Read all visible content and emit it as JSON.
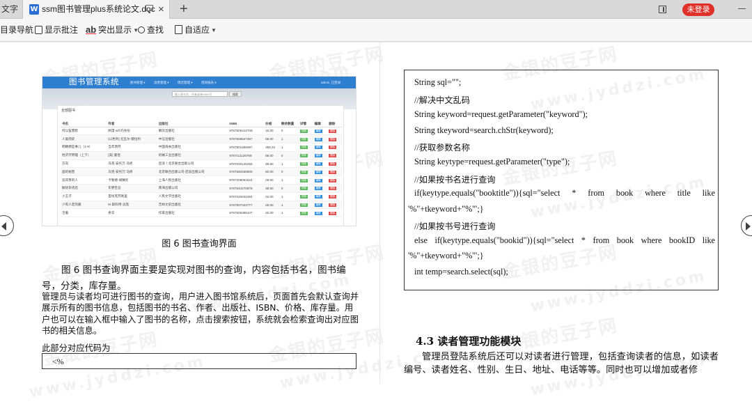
{
  "tabs": {
    "prev_label": "文字",
    "active_label": "ssm图书管理plus系统论文.doc",
    "doc_badge": "W",
    "close_glyph": "×",
    "add_glyph": "+",
    "login_label": "未登录"
  },
  "toolbar": {
    "outline_label": "目录导航",
    "batch_label": "显示批注",
    "highlight_label": "突出显示",
    "find_label": "查找",
    "fit_label": "自适应"
  },
  "watermark": {
    "cn": "金银的豆子网",
    "en": "www.jyddzi.com"
  },
  "screenshot": {
    "brand": "图书管理系统",
    "menus": [
      "图书管理 ▾",
      "读者管理 ▾",
      "借还管理 ▾",
      "借阅报表 ▾"
    ],
    "user": "admin, 已登录",
    "search_placeholder": "输入图书名、作者或者ISBN号",
    "search_button": "搜索",
    "panel_title": "全部图书",
    "headers": [
      "书名",
      "作者",
      "出版社",
      "ISBN",
      "价格",
      "剩余数量",
      "详情",
      "编辑",
      "删除"
    ],
    "btn_detail": "详情",
    "btn_edit": "编辑",
    "btn_delete": "删除",
    "rows": [
      [
        "何以笙箫默",
        "顾漫 sdf 的身份",
        "朝华出版社",
        "9787505414709",
        "15.00",
        "0"
      ],
      [
        "人类简史",
        "[以色列] 尤瓦尔·赫拉利",
        "中信出版社",
        "9787508647357",
        "68.00",
        "1"
      ],
      [
        "明朝那些事儿（1-9）",
        "当年明月",
        "中国海关出版社",
        "9787801656087",
        "358.20",
        "1"
      ],
      [
        "经济学原理（上下）",
        "[美] 曼昆",
        "机械工业出版社",
        "9787111126768",
        "88.00",
        "0"
      ],
      [
        "方向",
        "马克-安托万·马修",
        "后浪丨北京联合出版公司",
        "9787020125265",
        "99.80",
        "1"
      ],
      [
        "画的秘密",
        "马克-安托万·马修",
        "北京联合出版公司·后浪出版公司",
        "9787550269606",
        "60.00",
        "0"
      ],
      [
        "追风筝的人",
        "卡勒德·胡赛尼",
        "上海人民出版社",
        "9787208061644",
        "29.00",
        "1"
      ],
      [
        "解忧杂货店",
        "东野圭吾",
        "南海出版公司",
        "9787544270878",
        "39.50",
        "0"
      ],
      [
        "小王子",
        "圣埃克苏佩里",
        "人民文学出版社",
        "9787020042494",
        "22.00",
        "1"
      ],
      [
        "少有人走的路",
        "M·斯科特·派克",
        "吉林文史出版社",
        "9787807023777",
        "26.00",
        "1"
      ],
      [
        "活着",
        "余华",
        "作家出版社",
        "9787506365437",
        "20.00",
        "1"
      ]
    ]
  },
  "left_page": {
    "caption": "图 6 图书查询界面",
    "para1": "图 6 图书查询界面主要是实现对图书的查询，内容包括书名，图书编号，分类，库存量。",
    "para2": "管理员与读者均可进行图书的查询，用户进入图书馆系统后，页面首先会默认查询并展示所有的图书信息，包括图书的书名、作者、出版社、ISBN、价格、库存量。用户也可以在输入框中输入了图书的名称，点击搜索按钮，系统就会检索查询出对应图书的相关信息。",
    "para3": "此部分对应代码为",
    "code": "<%"
  },
  "right_page": {
    "code": {
      "l1": "String sql=\"\";",
      "l2": "//解决中文乱码",
      "l3": "String keyword=request.getParameter(\"keyword\");",
      "l4": "String tkeyword=search.chStr(keyword);",
      "l5": "//获取参数名称",
      "l6": "String keytype=request.getParameter(\"type\");",
      "l7": "//如果按书名进行查询",
      "l8": [
        "if(keytype.equals(\"booktitle\")){sql=\"select",
        "*",
        "from",
        "book",
        "where",
        "title",
        "like"
      ],
      "l8b": "'%\"+tkeyword+\"%'\";}",
      "l9": "//如果按书号进行查询",
      "l10": [
        "else",
        "if(keytype.equals(\"bookid\")){sql=\"select",
        "*",
        "from",
        "book",
        "where",
        "bookID",
        "like"
      ],
      "l10b": "'%\"+tkeyword+\"%'\";}",
      "l11": "int temp=search.select(sql);"
    },
    "section_title": "4.3  读者管理功能模块",
    "para": "管理员登陆系统后还可以对读者进行管理，包括查询读者的信息，如读者编号、读者姓名、性别、生日、地址、电话等等。同时也可以增加或者修"
  }
}
